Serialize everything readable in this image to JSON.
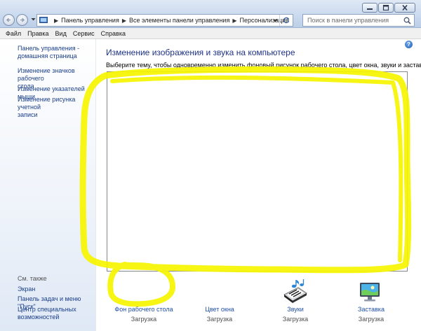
{
  "window": {
    "breadcrumb": [
      "Панель управления",
      "Все элементы панели управления",
      "Персонализация"
    ],
    "search_placeholder": "Поиск в панели управления"
  },
  "menu": [
    "Файл",
    "Правка",
    "Вид",
    "Сервис",
    "Справка"
  ],
  "sidebar": {
    "home_link_line1": "Панель управления -",
    "home_link_line2": "домашняя страница",
    "items": [
      {
        "line1": "Изменение значков рабочего",
        "line2": "стола"
      },
      {
        "line1": "Изменение указателей мыши",
        "line2": ""
      },
      {
        "line1": "Изменение рисунка учетной",
        "line2": "записи"
      }
    ],
    "see_also_heading": "См. также",
    "see_also": [
      {
        "line1": "Экран",
        "line2": ""
      },
      {
        "line1": "Панель задач и меню \"Пуск\"",
        "line2": ""
      },
      {
        "line1": "Центр специальных",
        "line2": "возможностей"
      }
    ]
  },
  "main": {
    "title": "Изменение изображения и звука на компьютере",
    "description": "Выберите тему, чтобы одновременно изменить фоновый рисунок рабочего стола, цвет окна, звуки и заставку.",
    "help_icon": "?"
  },
  "tiles": [
    {
      "label": "Фон рабочего стола",
      "status": "Загрузка",
      "icon": "desktop-background-icon"
    },
    {
      "label": "Цвет окна",
      "status": "Загрузка",
      "icon": "window-color-icon"
    },
    {
      "label": "Звуки",
      "status": "Загрузка",
      "icon": "sounds-icon"
    },
    {
      "label": "Заставка",
      "status": "Загрузка",
      "icon": "screensaver-icon"
    }
  ],
  "colors": {
    "link": "#1b3f8b",
    "title": "#1e3287",
    "highlight": "#f7f500"
  }
}
